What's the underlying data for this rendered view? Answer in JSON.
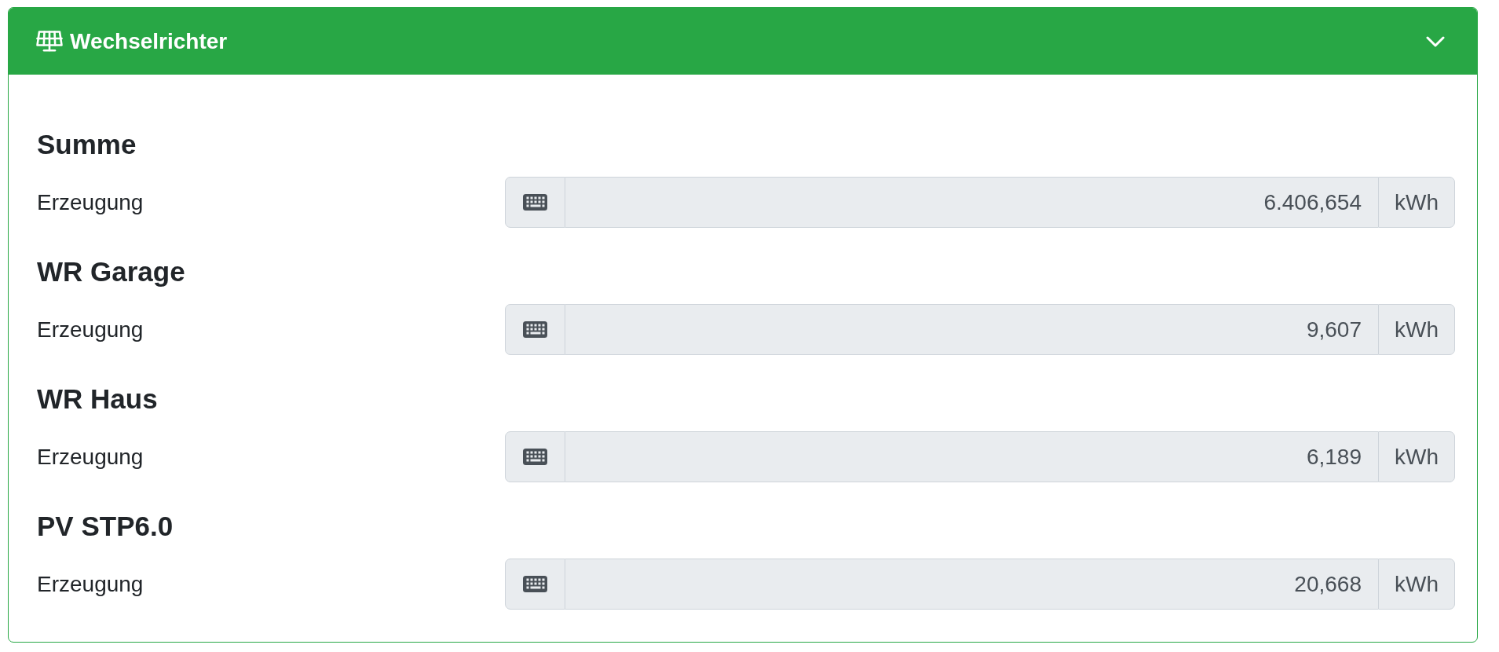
{
  "card": {
    "title": "Wechselrichter",
    "expanded": true
  },
  "sections": [
    {
      "heading": "Summe",
      "rows": [
        {
          "label": "Erzeugung",
          "value": "6.406,654",
          "unit": "kWh",
          "readonly": true
        }
      ]
    },
    {
      "heading": "WR Garage",
      "rows": [
        {
          "label": "Erzeugung",
          "value": "9,607",
          "unit": "kWh",
          "readonly": true
        }
      ]
    },
    {
      "heading": "WR Haus",
      "rows": [
        {
          "label": "Erzeugung",
          "value": "6,189",
          "unit": "kWh",
          "readonly": true
        }
      ]
    },
    {
      "heading": "PV STP6.0",
      "rows": [
        {
          "label": "Erzeugung",
          "value": "20,668",
          "unit": "kWh",
          "readonly": true
        }
      ]
    }
  ]
}
